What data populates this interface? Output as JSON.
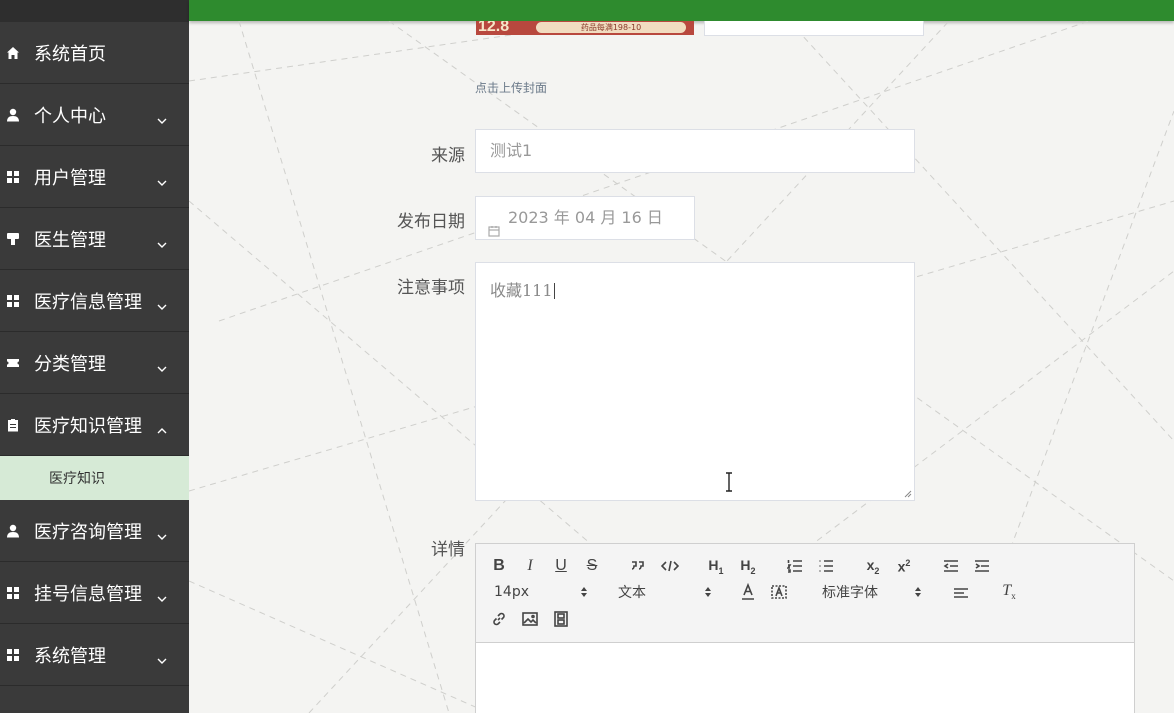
{
  "sidebar": {
    "items": [
      {
        "label": "系统首页",
        "icon": "home-icon",
        "expandable": false
      },
      {
        "label": "个人中心",
        "icon": "user-icon",
        "expandable": true
      },
      {
        "label": "用户管理",
        "icon": "grid-icon",
        "expandable": true
      },
      {
        "label": "医生管理",
        "icon": "stamp-icon",
        "expandable": true
      },
      {
        "label": "医疗信息管理",
        "icon": "grid-icon",
        "expandable": true
      },
      {
        "label": "分类管理",
        "icon": "ticket-icon",
        "expandable": true
      },
      {
        "label": "医疗知识管理",
        "icon": "clipboard-icon",
        "expandable": true,
        "expanded": true
      },
      {
        "label": "医疗咨询管理",
        "icon": "user-icon",
        "expandable": true
      },
      {
        "label": "挂号信息管理",
        "icon": "grid-icon",
        "expandable": true
      },
      {
        "label": "系统管理",
        "icon": "grid-icon",
        "expandable": true
      }
    ],
    "submenu": {
      "label": "医疗知识"
    }
  },
  "form": {
    "cover": {
      "thumb_big": "12.8",
      "thumb_text": "药品每满198-10",
      "hint": "点击上传封面"
    },
    "source": {
      "label": "来源",
      "value": "测试1"
    },
    "publish_date": {
      "label": "发布日期",
      "value": "2023 年 04 月 16 日"
    },
    "notes": {
      "label": "注意事项",
      "value": "收藏111"
    },
    "details": {
      "label": "详情"
    }
  },
  "editor": {
    "font_size": "14px",
    "block_type": "文本",
    "font_family": "标准字体"
  },
  "colors": {
    "sidebar_bg": "#3a3a3a",
    "topbar_accent": "#2e8b2e",
    "submenu_active_bg": "#d6ead6"
  }
}
